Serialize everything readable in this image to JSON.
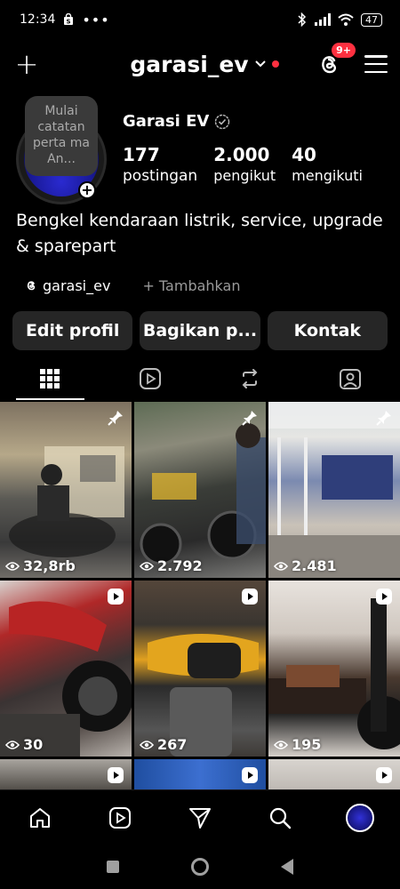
{
  "status_bar": {
    "time": "12:34",
    "battery": "47"
  },
  "header": {
    "username": "garasi_ev",
    "notification_badge": "9+"
  },
  "profile": {
    "note": "Mulai catatan perta ma An...",
    "display_name": "Garasi EV",
    "stats": [
      {
        "value": "177",
        "label": "postingan"
      },
      {
        "value": "2.000",
        "label": "pengikut"
      },
      {
        "value": "40",
        "label": "mengikuti"
      }
    ],
    "bio": "Bengkel kendaraan listrik, service, upgrade & sparepart",
    "threads_handle": "garasi_ev",
    "add_link_label": "+ Tambahkan"
  },
  "actions": {
    "edit": "Edit profil",
    "share": "Bagikan p...",
    "contact": "Kontak"
  },
  "tabs": [
    "grid",
    "reels",
    "reposts",
    "tagged"
  ],
  "grid": {
    "posts": [
      {
        "views": "32,8rb",
        "badge": "pin"
      },
      {
        "views": "2.792",
        "badge": "pin"
      },
      {
        "views": "2.481",
        "badge": "pin"
      },
      {
        "views": "30",
        "badge": "reel"
      },
      {
        "views": "267",
        "badge": "reel"
      },
      {
        "views": "195",
        "badge": "reel"
      },
      {
        "views": "",
        "badge": "reel"
      },
      {
        "views": "",
        "badge": "reel"
      },
      {
        "views": "",
        "badge": "reel"
      }
    ]
  },
  "colors": {
    "background": "#000000",
    "button": "#262626",
    "accent_red": "#ff3040"
  }
}
